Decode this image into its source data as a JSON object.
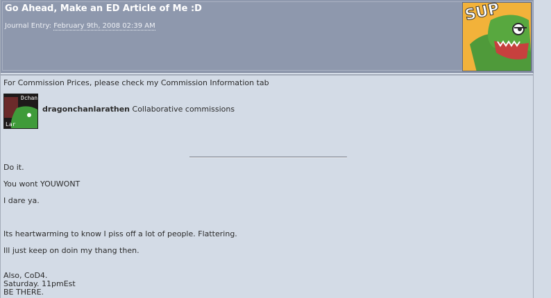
{
  "journal": {
    "title": "Go Ahead, Make an ED Article of Me :D",
    "entry_label": "Journal Entry:",
    "date": "February 9th, 2008 02:39 AM",
    "avatar_text": "SUP"
  },
  "notice": "For Commission Prices, please check my Commission Information tab",
  "collab": {
    "avatar_top_text": "Dchan",
    "avatar_bottom_text": "Lar",
    "username": "dragonchanlarathen",
    "text": "Collaborative commissions"
  },
  "body": {
    "p1": "Do it.",
    "p2": "You wont YOUWONT",
    "p3": "I dare ya.",
    "p4": "Its heartwarming to know I piss off a lot of people. Flattering.",
    "p5": "Ill just keep on doin my thang then.",
    "p6_line1": "Also, CoD4.",
    "p6_line2": "Saturday. 11pmEst",
    "p6_line3": "BE THERE."
  }
}
